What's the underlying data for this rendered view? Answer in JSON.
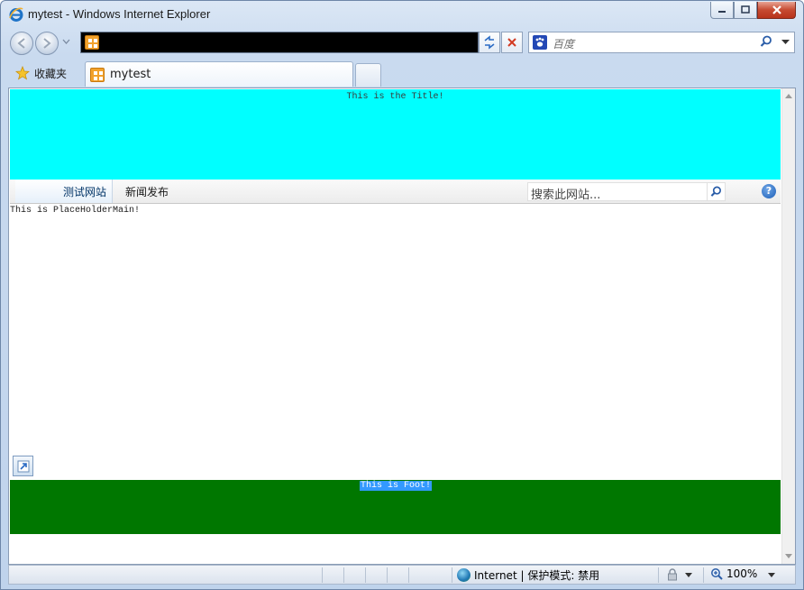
{
  "window": {
    "title": "mytest - Windows Internet Explorer"
  },
  "toolbar": {
    "search_placeholder": "百度"
  },
  "favorites": {
    "label": "收藏夹"
  },
  "tabs": [
    {
      "label": "mytest"
    }
  ],
  "page": {
    "title_text": "This is the Title!",
    "nav_items": [
      {
        "label": "测试网站",
        "selected": true
      },
      {
        "label": "新闻发布",
        "selected": false
      }
    ],
    "site_search_placeholder": "搜索此网站...",
    "main_text": "This is PlaceHolderMain!",
    "foot_text": "This is Foot!",
    "colors": {
      "title_bg": "#00ffff",
      "foot_bg": "#007700",
      "selection": "#3399ff"
    }
  },
  "statusbar": {
    "zone": "Internet | 保护模式: 禁用",
    "zoom": "100%"
  },
  "icons": [
    "ie-logo-icon",
    "back-icon",
    "forward-icon",
    "refresh-icon",
    "stop-icon",
    "baidu-icon",
    "search-icon",
    "star-icon",
    "page-icon",
    "help-icon",
    "globe-icon",
    "zoom-icon"
  ]
}
